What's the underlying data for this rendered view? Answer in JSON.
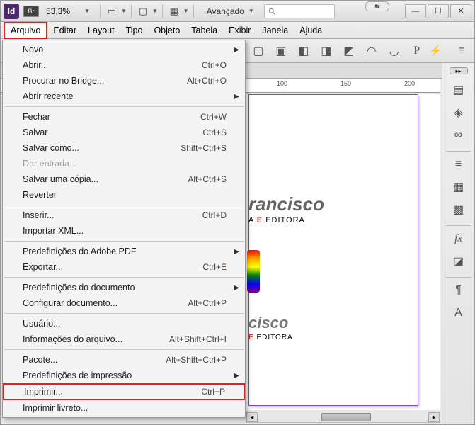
{
  "titlebar": {
    "app_abbrev": "Id",
    "bridge_abbrev": "Br",
    "zoom_value": "53,3%",
    "workspace_label": "Avançado"
  },
  "menubar": {
    "arquivo": "Arquivo",
    "editar": "Editar",
    "layout": "Layout",
    "tipo": "Tipo",
    "objeto": "Objeto",
    "tabela": "Tabela",
    "exibir": "Exibir",
    "janela": "Janela",
    "ajuda": "Ajuda"
  },
  "file_menu": {
    "novo": {
      "label": "Novo",
      "submenu": true
    },
    "abrir": {
      "label": "Abrir...",
      "shortcut": "Ctrl+O"
    },
    "procurar_bridge": {
      "label": "Procurar no Bridge...",
      "shortcut": "Alt+Ctrl+O"
    },
    "abrir_recente": {
      "label": "Abrir recente",
      "submenu": true
    },
    "fechar": {
      "label": "Fechar",
      "shortcut": "Ctrl+W"
    },
    "salvar": {
      "label": "Salvar",
      "shortcut": "Ctrl+S"
    },
    "salvar_como": {
      "label": "Salvar como...",
      "shortcut": "Shift+Ctrl+S"
    },
    "dar_entrada": {
      "label": "Dar entrada...",
      "disabled": true
    },
    "salvar_copia": {
      "label": "Salvar uma cópia...",
      "shortcut": "Alt+Ctrl+S"
    },
    "reverter": {
      "label": "Reverter"
    },
    "inserir": {
      "label": "Inserir...",
      "shortcut": "Ctrl+D"
    },
    "importar_xml": {
      "label": "Importar XML..."
    },
    "predef_pdf": {
      "label": "Predefinições do Adobe PDF",
      "submenu": true
    },
    "exportar": {
      "label": "Exportar...",
      "shortcut": "Ctrl+E"
    },
    "predef_doc": {
      "label": "Predefinições do documento",
      "submenu": true
    },
    "config_doc": {
      "label": "Configurar documento...",
      "shortcut": "Alt+Ctrl+P"
    },
    "usuario": {
      "label": "Usuário..."
    },
    "info_arquivo": {
      "label": "Informações do arquivo...",
      "shortcut": "Alt+Shift+Ctrl+I"
    },
    "pacote": {
      "label": "Pacote...",
      "shortcut": "Alt+Shift+Ctrl+P"
    },
    "predef_impressao": {
      "label": "Predefinições de impressão",
      "submenu": true
    },
    "imprimir": {
      "label": "Imprimir...",
      "shortcut": "Ctrl+P"
    },
    "imprimir_livreto": {
      "label": "Imprimir livreto..."
    }
  },
  "ruler": {
    "ticks": [
      "100",
      "150",
      "200"
    ]
  },
  "canvas": {
    "brand_text": "rancisco",
    "brand_sub_a": "A ",
    "brand_sub_e": "E",
    "brand_sub_b": " EDITORA",
    "brand2_text": "cisco",
    "brand2_sub_b": " EDITORA"
  },
  "toolbar2": {
    "p_glyph": "P"
  }
}
